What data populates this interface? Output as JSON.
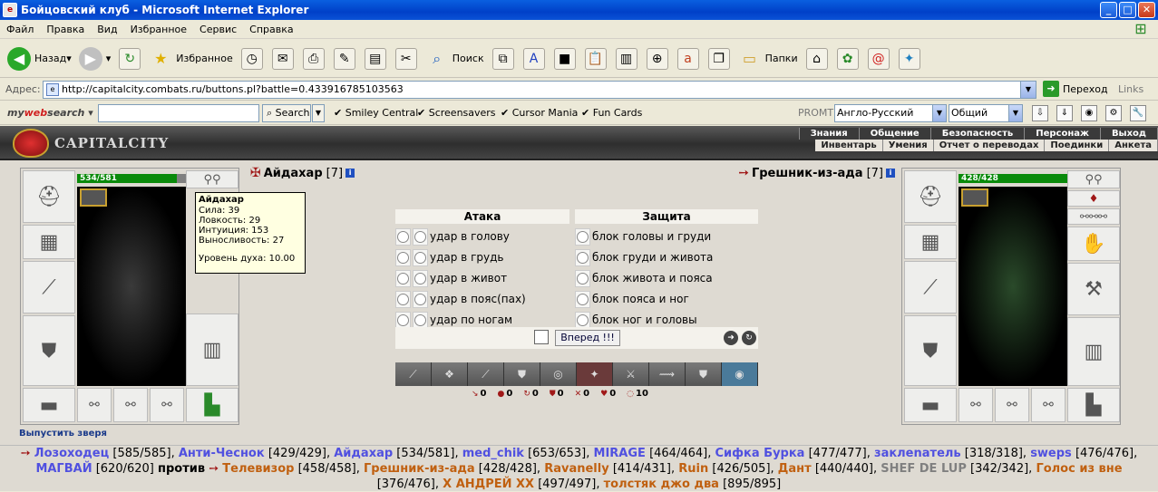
{
  "window": {
    "title": "Бойцовский клуб - Microsoft Internet Explorer",
    "min": "_",
    "max": "□",
    "close": "✕"
  },
  "menu": [
    "Файл",
    "Правка",
    "Вид",
    "Избранное",
    "Сервис",
    "Справка"
  ],
  "toolbar": {
    "back": "Назад",
    "favorites": "Избранное",
    "search": "Поиск",
    "folders": "Папки"
  },
  "address": {
    "label": "Адрес:",
    "url": "http://capitalcity.combats.ru/buttons.pl?battle=0.433916785103563",
    "go": "Переход",
    "links": "Links"
  },
  "mws": {
    "brand_a": "my",
    "brand_b": "web",
    "brand_c": "search",
    "search_btn": "Search",
    "items": [
      "Smiley Central",
      "Screensavers",
      "Cursor Mania",
      "Fun Cards"
    ],
    "promt": "PROMT",
    "lang": "Англо-Русский",
    "mode": "Общий"
  },
  "game": {
    "logo": "CAPITALCITY",
    "nav1": [
      "Знания",
      "Общение",
      "Безопасность",
      "Персонаж",
      "Выход"
    ],
    "nav2": [
      "Инвентарь",
      "Умения",
      "Отчет о переводах",
      "Поединки",
      "Анкета"
    ],
    "left": {
      "hp": "534/581",
      "hp_frac": 0.919,
      "name": "Айдахар",
      "level": "[7]"
    },
    "right": {
      "hp": "428/428",
      "hp_frac": 1.0,
      "name": "Грешник-из-ада",
      "level": "[7]"
    },
    "tooltip": {
      "name": "Айдахар",
      "lines": [
        "Сила: 39",
        "Ловкость: 29",
        "Интуиция: 153",
        "Выносливость: 27",
        "",
        "Уровень духа: 10.00"
      ]
    },
    "attack_title": "Атака",
    "defense_title": "Защита",
    "attacks": [
      "удар в голову",
      "удар в грудь",
      "удар в живот",
      "удар в пояс(пах)",
      "удар по ногам"
    ],
    "defenses": [
      "блок головы и груди",
      "блок груди и живота",
      "блок живота и пояса",
      "блок пояса и ног",
      "блок ног и головы"
    ],
    "forward": "Вперед !!!",
    "stats": [
      "0",
      "0",
      "0",
      "0",
      "0",
      "0",
      "10"
    ],
    "release": "Выпустить зверя",
    "team1": [
      {
        "n": "Лозоходец",
        "hp": "[585/585]",
        "c": "blue",
        "arrow": true
      },
      {
        "n": "Анти-Чеснок",
        "hp": "[429/429]",
        "c": "blue"
      },
      {
        "n": "Айдахар",
        "hp": "[534/581]",
        "c": "blue"
      },
      {
        "n": "med_chik",
        "hp": "[653/653]",
        "c": "blue"
      },
      {
        "n": "MIRAGE",
        "hp": "[464/464]",
        "c": "blue"
      },
      {
        "n": "Сифка Бурка",
        "hp": "[477/477]",
        "c": "blue"
      },
      {
        "n": "заклenатель",
        "hp": "[318/318]",
        "c": "blue"
      },
      {
        "n": "sweps",
        "hp": "[476/476]",
        "c": "blue"
      },
      {
        "n": "МАГВАЙ",
        "hp": "[620/620]",
        "c": "blue"
      }
    ],
    "vs": "против",
    "team2": [
      {
        "n": "Телевизор",
        "hp": "[458/458]",
        "c": "orange",
        "arrow": true
      },
      {
        "n": "Грешник-из-ада",
        "hp": "[428/428]",
        "c": "orange"
      },
      {
        "n": "Ravanelly",
        "hp": "[414/431]",
        "c": "orange"
      },
      {
        "n": "Ruin",
        "hp": "[426/505]",
        "c": "orange"
      },
      {
        "n": "Дант",
        "hp": "[440/440]",
        "c": "orange"
      },
      {
        "n": "SHEF DE LUP",
        "hp": "[342/342]",
        "c": "gray"
      },
      {
        "n": "Голос из вне",
        "hp": "[376/476]",
        "c": "orange"
      },
      {
        "n": "X АНДРЕЙ XX",
        "hp": "[497/497]",
        "c": "orange"
      },
      {
        "n": "толстяк джо два",
        "hp": "[895/895]",
        "c": "orange"
      }
    ]
  }
}
